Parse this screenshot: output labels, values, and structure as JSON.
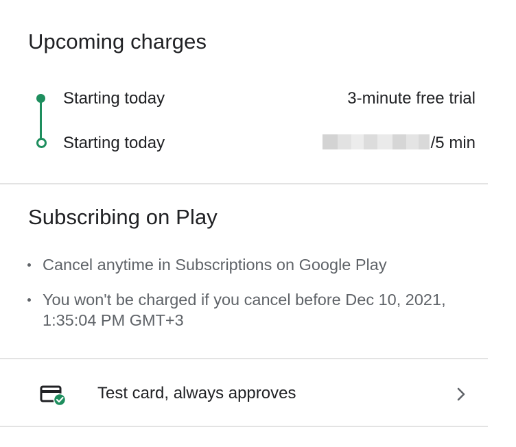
{
  "upcoming": {
    "title": "Upcoming charges",
    "charges": [
      {
        "label": "Starting today",
        "value": "3-minute free trial"
      },
      {
        "label": "Starting today",
        "value_suffix": "/5 min"
      }
    ]
  },
  "subscribing": {
    "title": "Subscribing on Play",
    "bullets": [
      "Cancel anytime in Subscriptions on Google Play",
      "You won't be charged if you cancel before Dec 10, 2021, 1:35:04 PM GMT+3"
    ]
  },
  "payment": {
    "method_label": "Test card, always approves",
    "icon": "credit-card-check-icon",
    "chevron_icon": "chevron-right-icon"
  },
  "colors": {
    "accent": "#1e8e5e",
    "text_primary": "#202124",
    "text_secondary": "#5f6368",
    "divider": "#e3e3e3"
  }
}
